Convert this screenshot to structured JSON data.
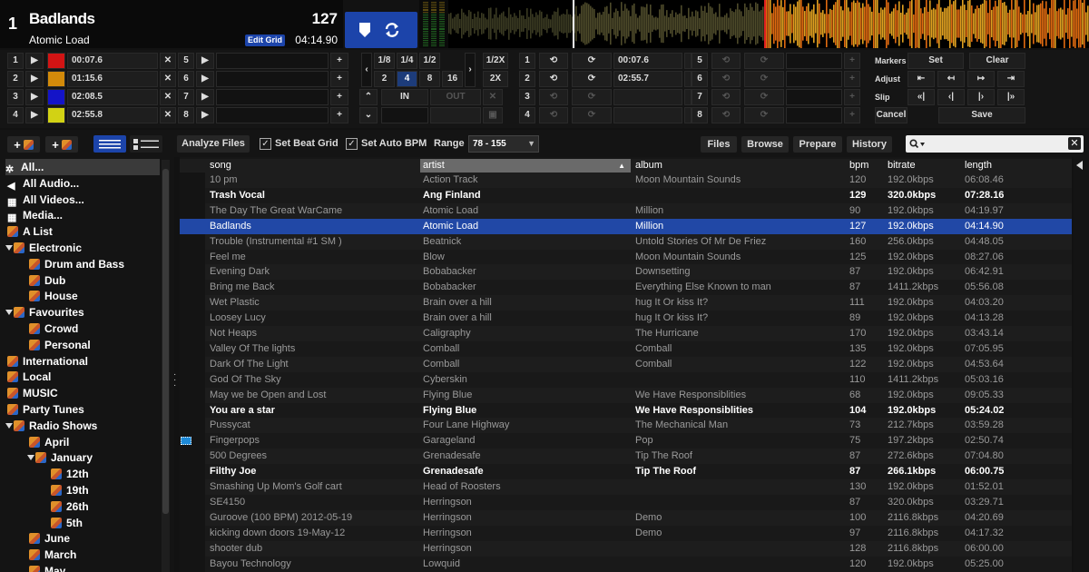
{
  "deck": {
    "number": "1",
    "title": "Badlands",
    "artist": "Atomic Load",
    "bpm": "127",
    "time": "04:14.90",
    "edit_grid_label": "Edit Grid"
  },
  "cues": [
    {
      "num": "1",
      "color": "#d21414",
      "time": "00:07.6"
    },
    {
      "num": "2",
      "color": "#d28a0a",
      "time": "01:15.6"
    },
    {
      "num": "3",
      "color": "#1414c8",
      "time": "02:08.5"
    },
    {
      "num": "4",
      "color": "#d2d214",
      "time": "02:55.8"
    }
  ],
  "cues2_nums": [
    "5",
    "6",
    "7",
    "8"
  ],
  "loop_fracs": [
    "1/8",
    "1/4",
    "1/2"
  ],
  "loop_ints": [
    "2",
    "4",
    "8",
    "16"
  ],
  "loop_mult": [
    "1/2X",
    "2X"
  ],
  "in_label": "IN",
  "out_label": "OUT",
  "saved_loops": [
    {
      "num": "1",
      "time": "00:07.6"
    },
    {
      "num": "2",
      "time": "02:55.7"
    },
    {
      "num": "3",
      "time": ""
    },
    {
      "num": "4",
      "time": ""
    }
  ],
  "saved_loops2_nums": [
    "5",
    "6",
    "7",
    "8"
  ],
  "markers": {
    "label": "Markers",
    "set": "Set",
    "clear": "Clear",
    "adjust": "Adjust",
    "slip": "Slip",
    "cancel": "Cancel",
    "save": "Save"
  },
  "toolbar": {
    "analyze": "Analyze Files",
    "set_beat_grid": "Set Beat Grid",
    "set_auto_bpm": "Set Auto BPM",
    "range_label": "Range",
    "range_value": "78 - 155",
    "files": "Files",
    "browse": "Browse",
    "prepare": "Prepare",
    "history": "History"
  },
  "sidebar": [
    {
      "label": "All...",
      "level": 0,
      "icon": "gear"
    },
    {
      "label": "All Audio...",
      "level": 0,
      "icon": "speaker"
    },
    {
      "label": "All Videos...",
      "level": 0,
      "icon": "film"
    },
    {
      "label": "Media...",
      "level": 0,
      "icon": "film"
    },
    {
      "label": "A List",
      "level": 0,
      "icon": "cube"
    },
    {
      "label": "Electronic",
      "level": 0,
      "icon": "cube",
      "open": true
    },
    {
      "label": "Drum and Bass",
      "level": 1,
      "icon": "cube"
    },
    {
      "label": "Dub",
      "level": 1,
      "icon": "cube"
    },
    {
      "label": "House",
      "level": 1,
      "icon": "cube"
    },
    {
      "label": "Favourites",
      "level": 0,
      "icon": "cube",
      "open": true
    },
    {
      "label": "Crowd",
      "level": 1,
      "icon": "cube"
    },
    {
      "label": "Personal",
      "level": 1,
      "icon": "cube"
    },
    {
      "label": "International",
      "level": 0,
      "icon": "cube"
    },
    {
      "label": "Local",
      "level": 0,
      "icon": "cube"
    },
    {
      "label": "MUSIC",
      "level": 0,
      "icon": "cube"
    },
    {
      "label": "Party Tunes",
      "level": 0,
      "icon": "cube"
    },
    {
      "label": "Radio Shows",
      "level": 0,
      "icon": "cube",
      "open": true
    },
    {
      "label": "April",
      "level": 1,
      "icon": "cube"
    },
    {
      "label": "January",
      "level": 1,
      "icon": "cube",
      "open": true
    },
    {
      "label": "12th",
      "level": 2,
      "icon": "cube"
    },
    {
      "label": "19th",
      "level": 2,
      "icon": "cube"
    },
    {
      "label": "26th",
      "level": 2,
      "icon": "cube"
    },
    {
      "label": "5th",
      "level": 2,
      "icon": "cube"
    },
    {
      "label": "June",
      "level": 1,
      "icon": "cube"
    },
    {
      "label": "March",
      "level": 1,
      "icon": "cube"
    },
    {
      "label": "May",
      "level": 1,
      "icon": "cube"
    }
  ],
  "table": {
    "columns": [
      "song",
      "artist",
      "album",
      "bpm",
      "bitrate",
      "length"
    ],
    "rows": [
      {
        "song": "10 pm",
        "artist": "Action Track",
        "album": "Moon Mountain Sounds",
        "bpm": "120",
        "bitrate": "192.0kbps",
        "length": "06:08.46",
        "style": "dim"
      },
      {
        "song": "Trash Vocal",
        "artist": "Ang Finland",
        "album": "",
        "bpm": "129",
        "bitrate": "320.0kbps",
        "length": "07:28.16",
        "style": "bright"
      },
      {
        "song": "The Day The Great WarCame",
        "artist": "Atomic Load",
        "album": "Million",
        "bpm": "90",
        "bitrate": "192.0kbps",
        "length": "04:19.97",
        "style": "dim"
      },
      {
        "song": "Badlands",
        "artist": "Atomic Load",
        "album": "Million",
        "bpm": "127",
        "bitrate": "192.0kbps",
        "length": "04:14.90",
        "style": "sel"
      },
      {
        "song": "Trouble (Instrumental #1 SM )",
        "artist": "Beatnick",
        "album": "Untold Stories Of Mr De Friez",
        "bpm": "160",
        "bitrate": "256.0kbps",
        "length": "04:48.05",
        "style": "dim"
      },
      {
        "song": "Feel me",
        "artist": "Blow",
        "album": "Moon Mountain Sounds",
        "bpm": "125",
        "bitrate": "192.0kbps",
        "length": "08:27.06",
        "style": "dim"
      },
      {
        "song": "Evening Dark",
        "artist": "Bobabacker",
        "album": "Downsetting",
        "bpm": "87",
        "bitrate": "192.0kbps",
        "length": "06:42.91",
        "style": "dim"
      },
      {
        "song": "Bring me Back",
        "artist": "Bobabacker",
        "album": "Everything Else Known to man",
        "bpm": "87",
        "bitrate": "1411.2kbps",
        "length": "05:56.08",
        "style": "dim"
      },
      {
        "song": "Wet Plastic",
        "artist": "Brain over a hill",
        "album": "hug It Or kiss It?",
        "bpm": "111",
        "bitrate": "192.0kbps",
        "length": "04:03.20",
        "style": "dim"
      },
      {
        "song": "Loosey Lucy",
        "artist": "Brain over a hill",
        "album": "hug It Or kiss It?",
        "bpm": "89",
        "bitrate": "192.0kbps",
        "length": "04:13.28",
        "style": "dim"
      },
      {
        "song": "Not Heaps",
        "artist": "Caligraphy",
        "album": "The Hurricane",
        "bpm": "170",
        "bitrate": "192.0kbps",
        "length": "03:43.14",
        "style": "dim"
      },
      {
        "song": "Valley Of The lights",
        "artist": "Comball",
        "album": "Comball",
        "bpm": "135",
        "bitrate": "192.0kbps",
        "length": "07:05.95",
        "style": "dim"
      },
      {
        "song": "Dark Of The Light",
        "artist": "Comball",
        "album": "Comball",
        "bpm": "122",
        "bitrate": "192.0kbps",
        "length": "04:53.64",
        "style": "dim"
      },
      {
        "song": "God Of The Sky",
        "artist": "Cyberskin",
        "album": "",
        "bpm": "110",
        "bitrate": "1411.2kbps",
        "length": "05:03.16",
        "style": "dim"
      },
      {
        "song": "May we be Open and Lost",
        "artist": "Flying Blue",
        "album": "We Have Responsiblities",
        "bpm": "68",
        "bitrate": "192.0kbps",
        "length": "09:05.33",
        "style": "dim"
      },
      {
        "song": "You are a star",
        "artist": "Flying Blue",
        "album": "We Have Responsiblities",
        "bpm": "104",
        "bitrate": "192.0kbps",
        "length": "05:24.02",
        "style": "bright"
      },
      {
        "song": "Pussycat",
        "artist": "Four Lane Highway",
        "album": "The Mechanical Man",
        "bpm": "73",
        "bitrate": "212.7kbps",
        "length": "03:59.28",
        "style": "dim"
      },
      {
        "song": "Fingerpops",
        "artist": "Garageland",
        "album": "Pop",
        "bpm": "75",
        "bitrate": "197.2kbps",
        "length": "02:50.74",
        "style": "dim",
        "marker": true
      },
      {
        "song": "500 Degrees",
        "artist": "Grenadesafe",
        "album": "Tip The Roof",
        "bpm": "87",
        "bitrate": "272.6kbps",
        "length": "07:04.80",
        "style": "dim"
      },
      {
        "song": "Filthy Joe",
        "artist": "Grenadesafe",
        "album": "Tip The Roof",
        "bpm": "87",
        "bitrate": "266.1kbps",
        "length": "06:00.75",
        "style": "bright"
      },
      {
        "song": "Smashing Up Mom's Golf cart",
        "artist": "Head of Roosters",
        "album": "",
        "bpm": "130",
        "bitrate": "192.0kbps",
        "length": "01:52.01",
        "style": "dim"
      },
      {
        "song": "SE4150",
        "artist": "Herringson",
        "album": "",
        "bpm": "87",
        "bitrate": "320.0kbps",
        "length": "03:29.71",
        "style": "dim"
      },
      {
        "song": "Guroove (100 BPM) 2012-05-19",
        "artist": "Herringson",
        "album": "Demo",
        "bpm": "100",
        "bitrate": "2116.8kbps",
        "length": "04:20.69",
        "style": "dim"
      },
      {
        "song": "kicking down doors 19-May-12",
        "artist": "Herringson",
        "album": "Demo",
        "bpm": "97",
        "bitrate": "2116.8kbps",
        "length": "04:17.32",
        "style": "dim"
      },
      {
        "song": "shooter dub",
        "artist": "Herringson",
        "album": "",
        "bpm": "128",
        "bitrate": "2116.8kbps",
        "length": "06:00.00",
        "style": "dim"
      },
      {
        "song": "Bayou Technology",
        "artist": "Lowquid",
        "album": "",
        "bpm": "120",
        "bitrate": "192.0kbps",
        "length": "05:25.00",
        "style": "dim"
      }
    ]
  }
}
